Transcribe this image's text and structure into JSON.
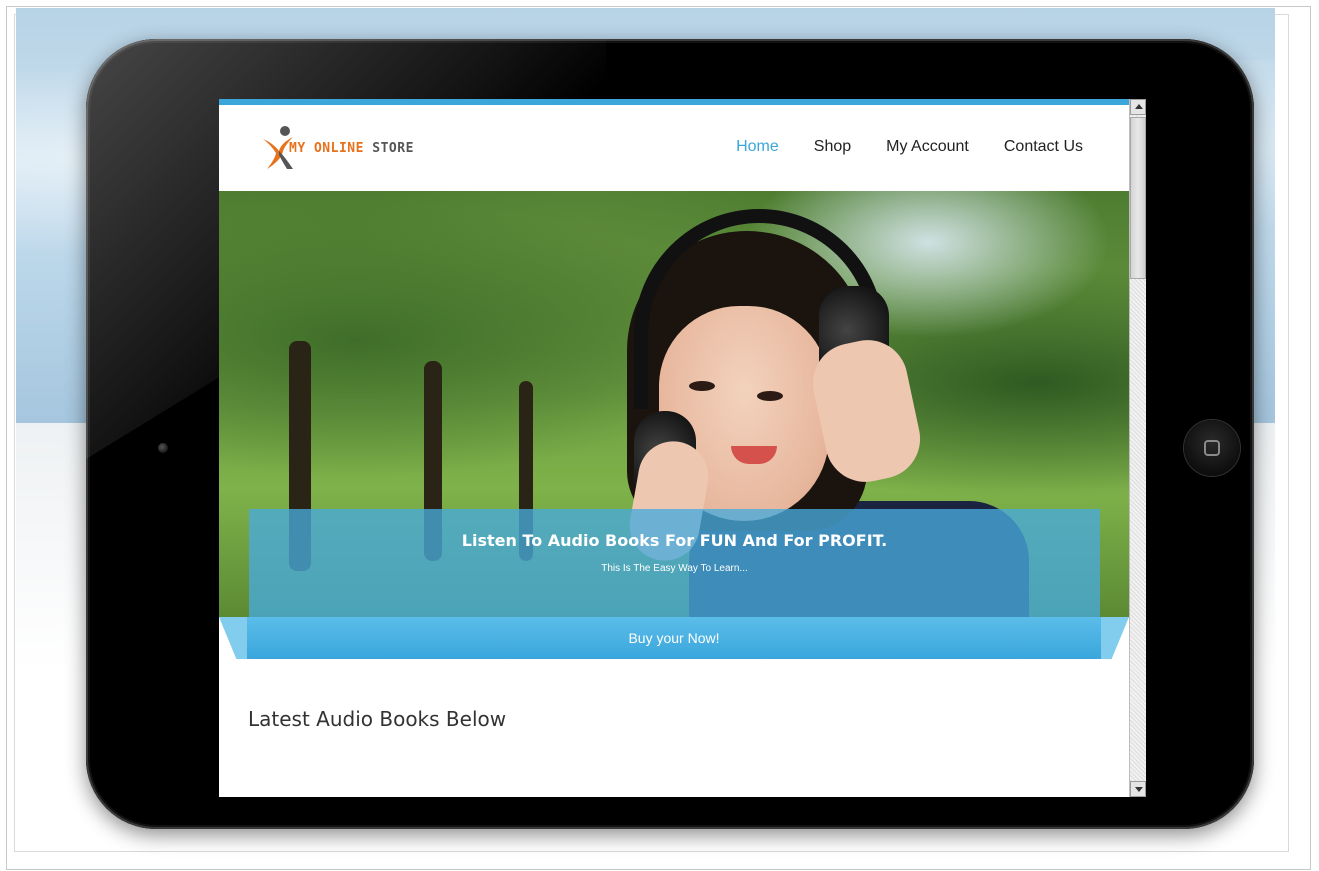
{
  "site": {
    "logo_text_accent": "MY ONLINE",
    "logo_text_rest": " STORE"
  },
  "nav": {
    "items": [
      {
        "label": "Home",
        "active": true
      },
      {
        "label": "Shop",
        "active": false
      },
      {
        "label": "My Account",
        "active": false
      },
      {
        "label": "Contact Us",
        "active": false
      }
    ]
  },
  "hero": {
    "title": "Listen To Audio Books For FUN And For PROFIT.",
    "subtitle": "This Is The Easy Way To Learn...",
    "cta_label": "Buy your Now!"
  },
  "content": {
    "section_title": "Latest Audio Books Below"
  },
  "icons": {
    "logo": "running-person-logo-icon",
    "home_button": "home-square-icon",
    "camera": "front-camera-icon",
    "scroll_up": "scroll-up-arrow-icon",
    "scroll_down": "scroll-down-arrow-icon"
  },
  "colors": {
    "accent": "#3ba6d9",
    "logo_orange": "#e8711c",
    "caption_overlay": "#48aadc",
    "text_dark": "#222222"
  }
}
